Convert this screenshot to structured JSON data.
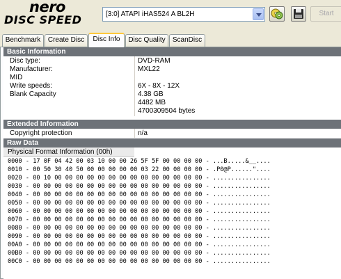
{
  "app": {
    "logo_top": "nero",
    "logo_bottom": "DISC SPEED"
  },
  "toolbar": {
    "drive": "[3:0]  ATAPI iHAS524   A BL2H",
    "start_label": "Start"
  },
  "tabs": [
    "Benchmark",
    "Create Disc",
    "Disc Info",
    "Disc Quality",
    "ScanDisc"
  ],
  "active_tab": "Disc Info",
  "basic": {
    "title": "Basic Information",
    "rows": [
      {
        "k": "Disc type:",
        "v": "DVD-RAM"
      },
      {
        "k": "Manufacturer:",
        "v": "MXL22"
      },
      {
        "k": "MID",
        "v": ""
      },
      {
        "k": "Write speeds:",
        "v": "6X - 8X - 12X"
      },
      {
        "k": "Blank Capacity",
        "v": "4.38 GB"
      },
      {
        "k": "",
        "v": "4482 MB"
      },
      {
        "k": "",
        "v": "4700309504 bytes"
      }
    ]
  },
  "extended": {
    "title": "Extended Information",
    "rows": [
      {
        "k": "Copyright protection",
        "v": "n/a"
      }
    ]
  },
  "raw": {
    "title": "Raw Data",
    "subtitle": "Physical Format Information (00h)",
    "lines": [
      "0000 - 17 0F 04 42 00 03 10 00 00 26 5F 5F 00 00 00 00 - ...B.....&__....",
      "0010 - 00 50 30 40 50 00 00 00 00 00 03 22 00 00 00 00 - .P0@P......\"....",
      "0020 - 00 10 00 00 00 00 00 00 00 00 00 00 00 00 00 00 - ................",
      "0030 - 00 00 00 00 00 00 00 00 00 00 00 00 00 00 00 00 - ................",
      "0040 - 00 00 00 00 00 00 00 00 00 00 00 00 00 00 00 00 - ................",
      "0050 - 00 00 00 00 00 00 00 00 00 00 00 00 00 00 00 00 - ................",
      "0060 - 00 00 00 00 00 00 00 00 00 00 00 00 00 00 00 00 - ................",
      "0070 - 00 00 00 00 00 00 00 00 00 00 00 00 00 00 00 00 - ................",
      "0080 - 00 00 00 00 00 00 00 00 00 00 00 00 00 00 00 00 - ................",
      "0090 - 00 00 00 00 00 00 00 00 00 00 00 00 00 00 00 00 - ................",
      "00A0 - 00 00 00 00 00 00 00 00 00 00 00 00 00 00 00 00 - ................",
      "00B0 - 00 00 00 00 00 00 00 00 00 00 00 00 00 00 00 00 - ................",
      "00C0 - 00 00 00 00 00 00 00 00 00 00 00 00 00 00 00 00 - ................"
    ]
  },
  "colors": {
    "section_bg": "#6d7278",
    "tab_highlight": "#ffc83c"
  }
}
